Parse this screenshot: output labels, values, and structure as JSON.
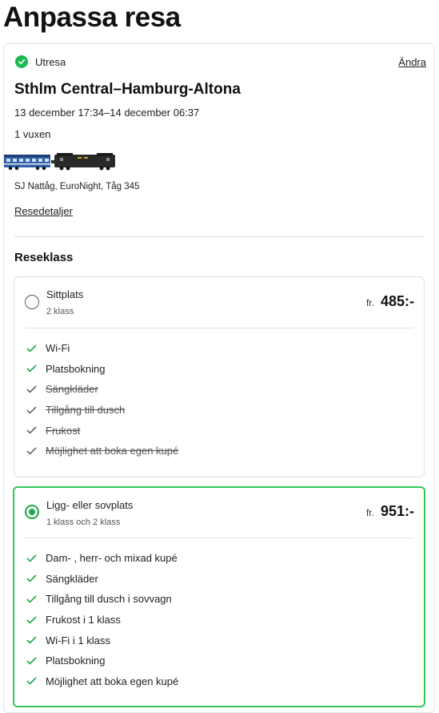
{
  "page": {
    "title": "Anpassa resa"
  },
  "journey": {
    "direction_label": "Utresa",
    "change_label": "Ändra",
    "route": "Sthlm Central–Hamburg-Altona",
    "date_range": "13 december 17:34–14 december 06:37",
    "passengers": "1 vuxen",
    "operator": "SJ Nattåg, EuroNight, Tåg 345",
    "details_link": "Resedetaljer"
  },
  "class_section": {
    "heading": "Reseklass",
    "options": [
      {
        "name": "Sittplats",
        "subtitle": "2 klass",
        "price_prefix": "fr.",
        "price": "485:-",
        "selected": false,
        "features": [
          {
            "label": "Wi-Fi",
            "available": true
          },
          {
            "label": "Platsbokning",
            "available": true
          },
          {
            "label": "Sängkläder",
            "available": false
          },
          {
            "label": "Tillgång till dusch",
            "available": false
          },
          {
            "label": "Frukost",
            "available": false
          },
          {
            "label": "Möjlighet att boka egen kupé",
            "available": false
          }
        ]
      },
      {
        "name": "Ligg- eller sovplats",
        "subtitle": "1 klass och 2 klass",
        "price_prefix": "fr.",
        "price": "951:-",
        "selected": true,
        "features": [
          {
            "label": "Dam- , herr- och mixad kupé",
            "available": true
          },
          {
            "label": "Sängkläder",
            "available": true
          },
          {
            "label": "Tillgång till dusch i sovvagn",
            "available": true
          },
          {
            "label": "Frukost i 1 klass",
            "available": true
          },
          {
            "label": "Wi-Fi i 1 klass",
            "available": true
          },
          {
            "label": "Platsbokning",
            "available": true
          },
          {
            "label": "Möjlighet att boka egen kupé",
            "available": true
          }
        ]
      }
    ]
  },
  "colors": {
    "accent_green": "#1ea84a",
    "check_green": "#1db954",
    "selected_border": "#35c75a"
  }
}
